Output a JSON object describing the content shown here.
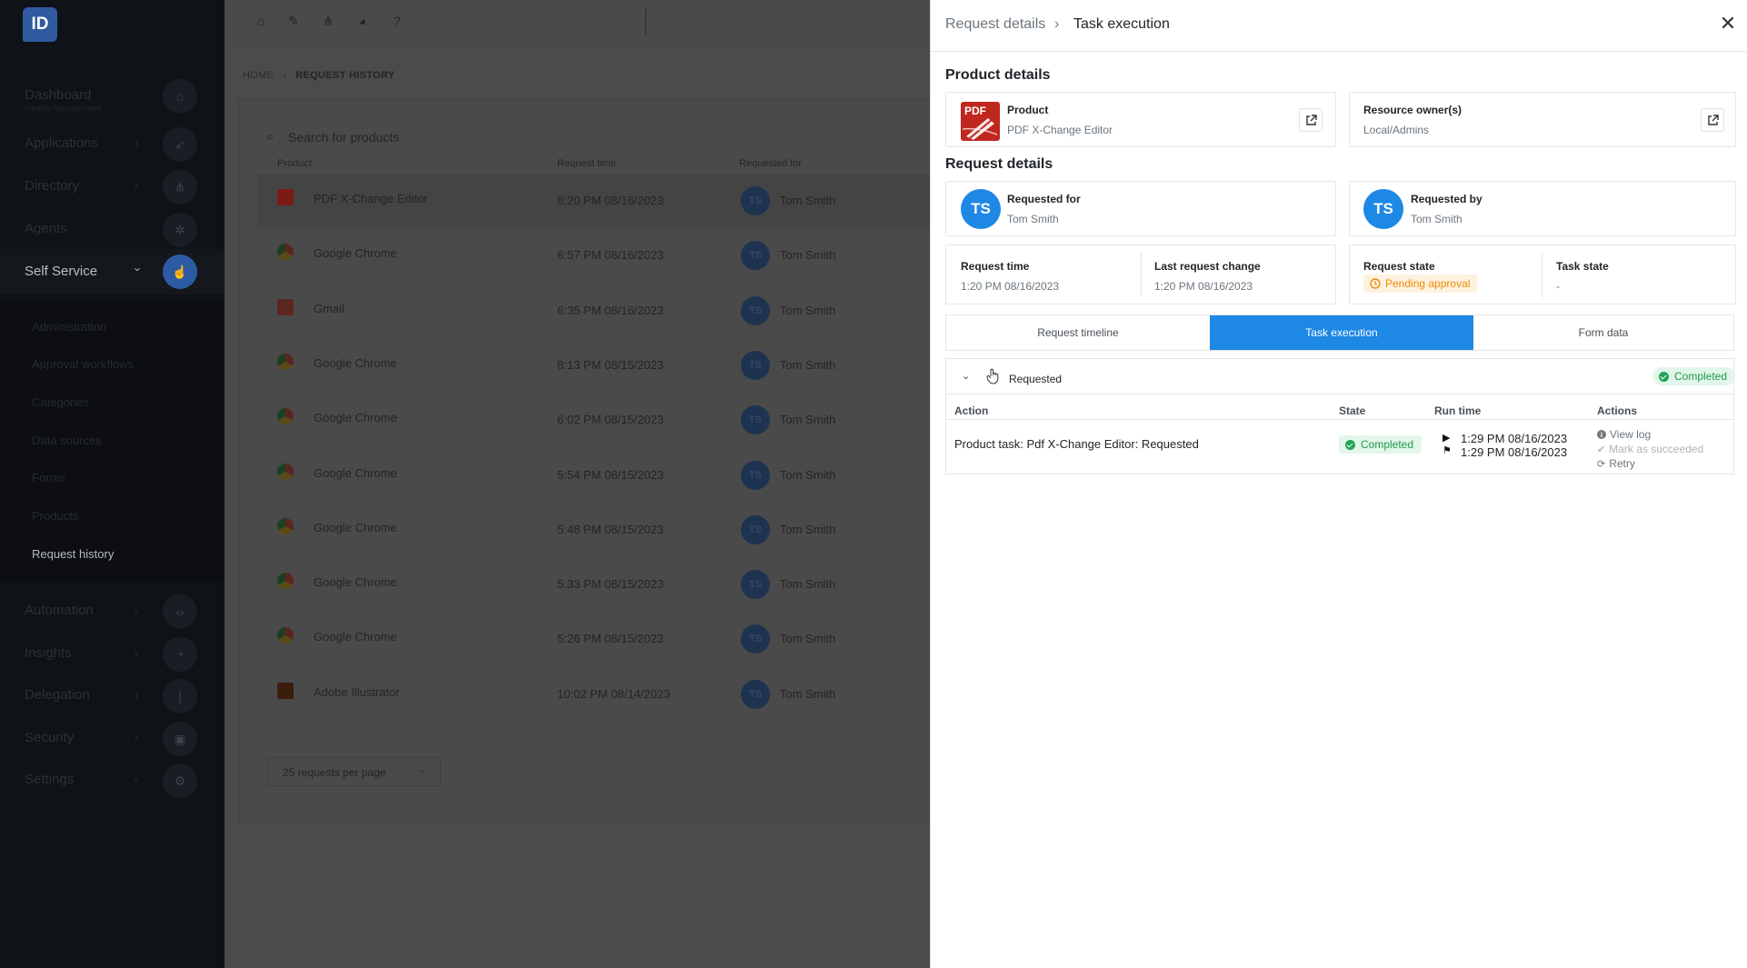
{
  "sidebar": {
    "logo": "ID",
    "items": [
      {
        "label": "Dashboard",
        "sub": "Identity Management",
        "icon": "home-icon"
      },
      {
        "label": "Applications",
        "icon": "rocket-icon"
      },
      {
        "label": "Directory",
        "icon": "sitemap-icon"
      },
      {
        "label": "Agents",
        "icon": "agents-icon"
      },
      {
        "label": "Self Service",
        "icon": "hand-pointer-icon"
      },
      {
        "label": "Automation",
        "icon": "code-icon"
      },
      {
        "label": "Insights",
        "icon": "lightbulb-icon"
      },
      {
        "label": "Delegation",
        "icon": "delegation-icon"
      },
      {
        "label": "Security",
        "icon": "lock-icon"
      },
      {
        "label": "Settings",
        "icon": "gear-icon"
      }
    ],
    "subitems": [
      "Administration",
      "Approval workflows",
      "Categories",
      "Data sources",
      "Forms",
      "Products",
      "Request history"
    ]
  },
  "breadcrumb": {
    "home": "HOME",
    "current": "REQUEST HISTORY"
  },
  "list": {
    "search_placeholder": "Search for products",
    "headers": {
      "product": "Product",
      "time": "Request time",
      "for": "Requested for"
    },
    "rows": [
      {
        "product": "PDF X-Change Editor",
        "time": "8:20 PM 08/16/2023",
        "initials": "TS",
        "user": "Tom Smith",
        "icon": "pdf-icon"
      },
      {
        "product": "Google Chrome",
        "time": "6:57 PM 08/16/2023",
        "initials": "TS",
        "user": "Tom Smith",
        "icon": "chrome-icon"
      },
      {
        "product": "Gmail",
        "time": "6:35 PM 08/16/2023",
        "initials": "TS",
        "user": "Tom Smith",
        "icon": "gmail-icon"
      },
      {
        "product": "Google Chrome",
        "time": "8:13 PM 08/15/2023",
        "initials": "TS",
        "user": "Tom Smith",
        "icon": "chrome-icon"
      },
      {
        "product": "Google Chrome",
        "time": "6:02 PM 08/15/2023",
        "initials": "TS",
        "user": "Tom Smith",
        "icon": "chrome-icon"
      },
      {
        "product": "Google Chrome",
        "time": "5:54 PM 08/15/2023",
        "initials": "TS",
        "user": "Tom Smith",
        "icon": "chrome-icon"
      },
      {
        "product": "Google Chrome",
        "time": "5:48 PM 08/15/2023",
        "initials": "TS",
        "user": "Tom Smith",
        "icon": "chrome-icon"
      },
      {
        "product": "Google Chrome",
        "time": "5:33 PM 08/15/2023",
        "initials": "TS",
        "user": "Tom Smith",
        "icon": "chrome-icon"
      },
      {
        "product": "Google Chrome",
        "time": "5:26 PM 08/15/2023",
        "initials": "TS",
        "user": "Tom Smith",
        "icon": "chrome-icon"
      },
      {
        "product": "Adobe Illustrator",
        "time": "10:02 PM 08/14/2023",
        "initials": "TS",
        "user": "Tom Smith",
        "icon": "illustrator-icon"
      }
    ],
    "pager": "25 requests per page"
  },
  "panel": {
    "breadcrumb_parent": "Request details",
    "breadcrumb_sep": "›",
    "breadcrumb_current": "Task execution",
    "close": "✕",
    "product_section": "Product details",
    "product_label": "Product",
    "product_value": "PDF X-Change Editor",
    "pdf_icon_text": "PDF",
    "owner_label": "Resource owner(s)",
    "owner_value": "Local/Admins",
    "request_section": "Request details",
    "requested_for_label": "Requested for",
    "requested_for_value": "Tom Smith",
    "requested_by_label": "Requested by",
    "requested_by_value": "Tom Smith",
    "initials": "TS",
    "request_time_label": "Request time",
    "request_time_value": "1:20 PM 08/16/2023",
    "last_change_label": "Last request change",
    "last_change_value": "1:20 PM 08/16/2023",
    "request_state_label": "Request state",
    "request_state_value": "Pending approval",
    "task_state_label": "Task state",
    "task_state_value": "-",
    "tabs": [
      "Request timeline",
      "Task execution",
      "Form data"
    ],
    "active_tab": "Task execution",
    "group_label": "Requested",
    "group_status": "Completed",
    "table_headers": {
      "action": "Action",
      "state": "State",
      "run_time": "Run time",
      "actions": "Actions"
    },
    "task": {
      "action": "Product task: Pdf X-Change Editor: Requested",
      "state": "Completed",
      "start": "1:29 PM 08/16/2023",
      "end": "1:29 PM 08/16/2023",
      "view_log": "View log",
      "mark_succeeded": "Mark as succeeded",
      "retry": "Retry"
    },
    "colors": {
      "accent": "#1e88e5",
      "success": "#22a356",
      "warning": "#f08c00"
    }
  }
}
